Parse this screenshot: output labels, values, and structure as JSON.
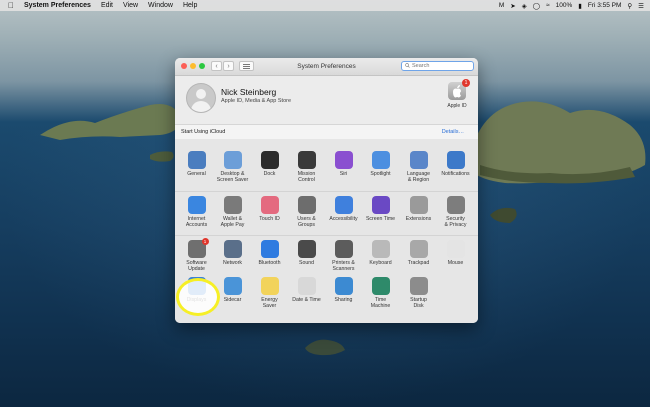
{
  "menubar": {
    "apple_icon": "apple-logo-icon",
    "app_name": "System Preferences",
    "items": [
      "Edit",
      "View",
      "Window",
      "Help"
    ],
    "clock": "Fri 3:55 PM",
    "battery": "100%"
  },
  "window": {
    "title": "System Preferences",
    "search_placeholder": "Search"
  },
  "user": {
    "name": "Nick Steinberg",
    "subtitle": "Apple ID, Media & App Store",
    "apple_id_label": "Apple ID",
    "apple_id_badge": "1"
  },
  "icloud": {
    "text": "Start Using iCloud",
    "details": "Details…"
  },
  "prefs": {
    "row1": [
      {
        "label1": "General",
        "label2": "",
        "color": "#4a7dbf",
        "icon": "general-icon"
      },
      {
        "label1": "Desktop &",
        "label2": "Screen Saver",
        "color": "#6c9ed8",
        "icon": "desktop-icon"
      },
      {
        "label1": "Dock",
        "label2": "",
        "color": "#2c2c2c",
        "icon": "dock-icon"
      },
      {
        "label1": "Mission",
        "label2": "Control",
        "color": "#3a3a3a",
        "icon": "mission-control-icon"
      },
      {
        "label1": "Siri",
        "label2": "",
        "color": "#8a4fd0",
        "icon": "siri-icon"
      },
      {
        "label1": "Spotlight",
        "label2": "",
        "color": "#4c8fe0",
        "icon": "spotlight-icon"
      },
      {
        "label1": "Language",
        "label2": "& Region",
        "color": "#5a86c9",
        "icon": "language-icon"
      },
      {
        "label1": "Notifications",
        "label2": "",
        "color": "#3c79c9",
        "icon": "notifications-icon"
      }
    ],
    "row2": [
      {
        "label1": "Internet",
        "label2": "Accounts",
        "color": "#3a86e0",
        "icon": "internet-accounts-icon"
      },
      {
        "label1": "Wallet &",
        "label2": "Apple Pay",
        "color": "#7a7a7a",
        "icon": "wallet-icon"
      },
      {
        "label1": "Touch ID",
        "label2": "",
        "color": "#e46a7f",
        "icon": "touch-id-icon"
      },
      {
        "label1": "Users &",
        "label2": "Groups",
        "color": "#6d6d6d",
        "icon": "users-icon"
      },
      {
        "label1": "Accessibility",
        "label2": "",
        "color": "#3f80dd",
        "icon": "accessibility-icon"
      },
      {
        "label1": "Screen Time",
        "label2": "",
        "color": "#6a49c4",
        "icon": "screen-time-icon"
      },
      {
        "label1": "Extensions",
        "label2": "",
        "color": "#9a9a9a",
        "icon": "extensions-icon"
      },
      {
        "label1": "Security",
        "label2": "& Privacy",
        "color": "#7d7d7d",
        "icon": "security-icon"
      }
    ],
    "row3": [
      {
        "label1": "Software",
        "label2": "Update",
        "color": "#6f6f6f",
        "icon": "software-update-icon",
        "badge": "1"
      },
      {
        "label1": "Network",
        "label2": "",
        "color": "#5a6f8a",
        "icon": "network-icon"
      },
      {
        "label1": "Bluetooth",
        "label2": "",
        "color": "#2f7be0",
        "icon": "bluetooth-icon"
      },
      {
        "label1": "Sound",
        "label2": "",
        "color": "#4a4a4a",
        "icon": "sound-icon"
      },
      {
        "label1": "Printers &",
        "label2": "Scanners",
        "color": "#5c5c5c",
        "icon": "printer-icon"
      },
      {
        "label1": "Keyboard",
        "label2": "",
        "color": "#b9b9b9",
        "icon": "keyboard-icon"
      },
      {
        "label1": "Trackpad",
        "label2": "",
        "color": "#a8a8a8",
        "icon": "trackpad-icon"
      },
      {
        "label1": "Mouse",
        "label2": "",
        "color": "#e4e4e4",
        "icon": "mouse-icon"
      }
    ],
    "row4": [
      {
        "label1": "Displays",
        "label2": "",
        "color": "#3b82d6",
        "icon": "displays-icon"
      },
      {
        "label1": "Sidecar",
        "label2": "",
        "color": "#4a94d8",
        "icon": "sidecar-icon"
      },
      {
        "label1": "Energy",
        "label2": "Saver",
        "color": "#f2d35b",
        "icon": "energy-saver-icon"
      },
      {
        "label1": "Date & Time",
        "label2": "",
        "color": "#d8d8d8",
        "icon": "date-time-icon"
      },
      {
        "label1": "Sharing",
        "label2": "",
        "color": "#3c8ad2",
        "icon": "sharing-icon"
      },
      {
        "label1": "Time",
        "label2": "Machine",
        "color": "#2e8a6a",
        "icon": "time-machine-icon"
      },
      {
        "label1": "Startup",
        "label2": "Disk",
        "color": "#8c8c8c",
        "icon": "startup-disk-icon"
      }
    ]
  },
  "colors": {
    "highlight": "#f6ef25",
    "link": "#2b6fd6",
    "badge": "#e0362c"
  }
}
